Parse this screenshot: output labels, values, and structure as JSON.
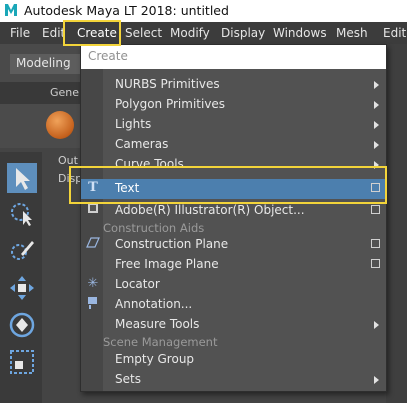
{
  "window": {
    "title": "Autodesk Maya LT 2018: untitled"
  },
  "menubar": {
    "items": [
      "File",
      "Edit",
      "Create",
      "Select",
      "Modify",
      "Display",
      "Windows",
      "Mesh",
      "Edit M"
    ]
  },
  "shelf": {
    "mode": "Modeling",
    "tab_left": "Gene",
    "outliner": "Out",
    "display": "Disp"
  },
  "create_menu": {
    "header": "Create",
    "items": [
      {
        "label": "NURBS Primitives",
        "submenu": true
      },
      {
        "label": "Polygon Primitives",
        "submenu": true
      },
      {
        "label": "Lights",
        "submenu": true
      },
      {
        "label": "Cameras",
        "submenu": true
      },
      {
        "label": "Curve Tools",
        "submenu": true
      },
      {
        "label": "Text",
        "option_box": true,
        "highlighted": true,
        "icon": "text-t-icon"
      },
      {
        "label": "Adobe(R) Illustrator(R) Object...",
        "option_box": true,
        "icon": "illustrator-icon"
      }
    ],
    "sections": {
      "construction_aids": "Construction Aids",
      "scene_management": "Scene Management"
    },
    "construction_items": [
      {
        "label": "Construction Plane",
        "option_box": true
      },
      {
        "label": "Free Image Plane",
        "option_box": true
      },
      {
        "label": "Locator",
        "icon": "locator-star-icon"
      },
      {
        "label": "Annotation...",
        "icon": "annotation-icon"
      },
      {
        "label": "Measure Tools",
        "submenu": true
      }
    ],
    "scene_items": [
      {
        "label": "Empty Group"
      },
      {
        "label": "Sets",
        "submenu": true
      }
    ]
  },
  "colors": {
    "highlight": "#4c7fae",
    "callout": "#f3d43a",
    "tool_selected": "#5e8fbd"
  }
}
